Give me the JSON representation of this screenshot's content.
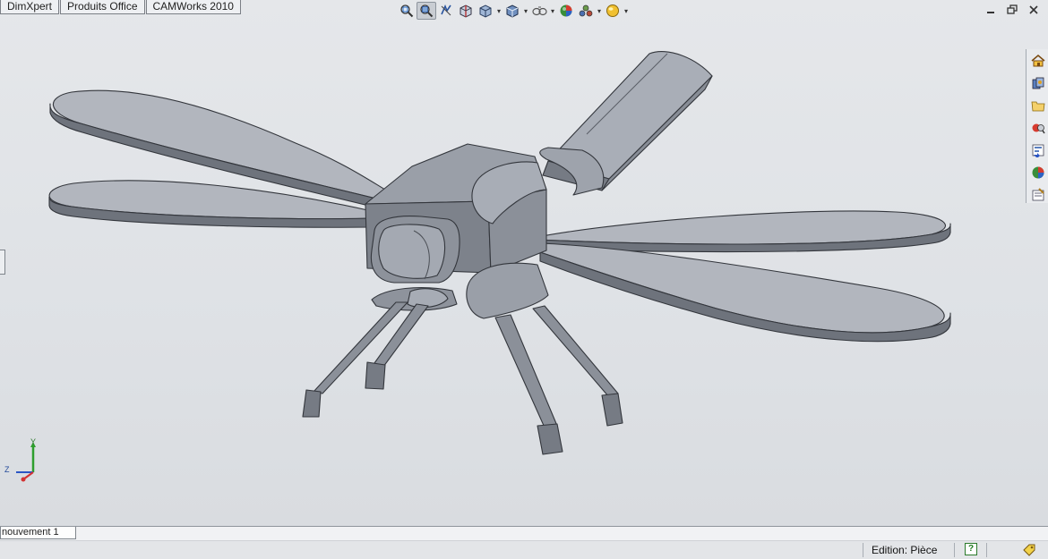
{
  "command_tabs": [
    "DimXpert",
    "Produits Office",
    "CAMWorks 2010"
  ],
  "hud_toolbar": [
    {
      "name": "zoom-to-fit-icon"
    },
    {
      "name": "zoom-to-area-icon",
      "active": true
    },
    {
      "name": "previous-view-icon"
    },
    {
      "name": "section-view-icon"
    },
    {
      "name": "view-orientation-icon",
      "dropdown": true
    },
    {
      "name": "display-style-icon",
      "dropdown": true
    },
    {
      "name": "hide-show-items-icon",
      "dropdown": true
    },
    {
      "name": "edit-appearance-icon"
    },
    {
      "name": "apply-scene-icon",
      "dropdown": true
    },
    {
      "name": "view-settings-icon",
      "dropdown": true
    }
  ],
  "window_controls": [
    "minimize-icon",
    "restore-icon",
    "close-icon"
  ],
  "task_pane": [
    "home-icon",
    "design-library-icon",
    "file-explorer-icon",
    "search-icon",
    "view-palette-icon",
    "appearances-icon",
    "custom-properties-icon"
  ],
  "triad_axes": {
    "y": "Y",
    "z": "Z"
  },
  "bottom_tab": "nouvement 1",
  "status": {
    "edit_mode": "Edition: Pièce"
  },
  "colors": {
    "part_body": "#8e939d",
    "part_light": "#adb2bb",
    "part_dark": "#6b7079",
    "edge": "#33363c",
    "background": "#e2e5e8"
  }
}
